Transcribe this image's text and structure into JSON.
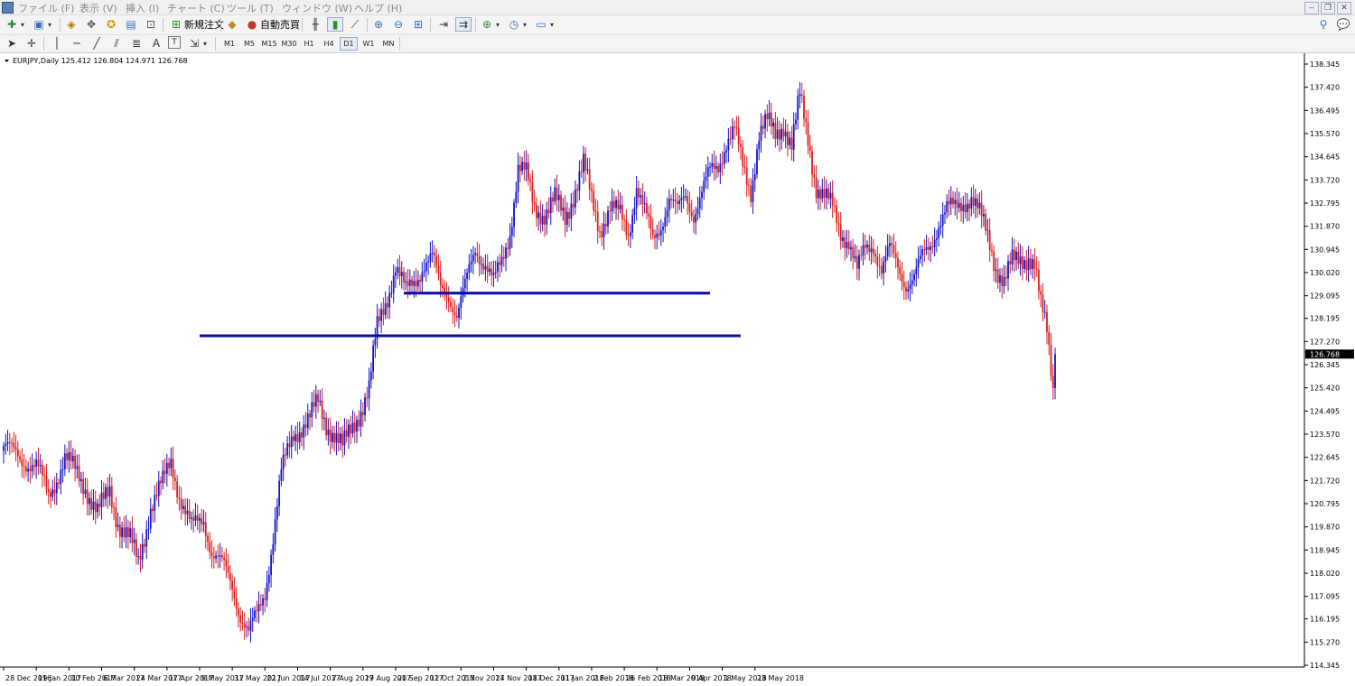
{
  "menu": {
    "items": [
      "ファイル (F)",
      "表示 (V)",
      "挿入 (I)",
      "チャート (C)",
      "ツール (T)",
      "ウィンドウ (W)",
      "ヘルプ (H)"
    ]
  },
  "toolbar": {
    "new_order_label": "新規注文",
    "auto_trade_label": "自動売買",
    "timeframes": [
      "M1",
      "M5",
      "M15",
      "M30",
      "H1",
      "H4",
      "D1",
      "W1",
      "MN"
    ],
    "active_timeframe": "D1",
    "text_tool_label": "A",
    "label_tool_label": "T"
  },
  "colors": {
    "bull": "#1414c8",
    "bear": "#dc1e1e",
    "level_line": "#0a0aa8",
    "price_tag_bg": "#000000"
  },
  "chart_data": {
    "type": "candlestick",
    "title": "EURJPY,Daily  125.412 126.804 124.971 126.768",
    "symbol": "EURJPY",
    "period": "Daily",
    "ohlc_header": {
      "open": 125.412,
      "high": 126.804,
      "low": 124.971,
      "close": 126.768
    },
    "last_price_label": "126.768",
    "last_price": 126.768,
    "ylim": [
      114.345,
      138.345
    ],
    "y_ticks": [
      "138.345",
      "137.420",
      "136.495",
      "135.570",
      "134.645",
      "133.720",
      "132.795",
      "131.870",
      "130.945",
      "130.020",
      "129.095",
      "128.195",
      "127.270",
      "126.345",
      "125.420",
      "124.495",
      "123.570",
      "122.645",
      "121.720",
      "120.795",
      "119.870",
      "118.945",
      "118.020",
      "117.095",
      "116.195",
      "115.270",
      "114.345"
    ],
    "x_ticks": [
      "28 Dec 2016",
      "19 Jan 2017",
      "10 Feb 2017",
      "6 Mar 2017",
      "24 Mar 2017",
      "17 Apr 2017",
      "9 May 2017",
      "31 May 2017",
      "22 Jun 2017",
      "14 Jul 2017",
      "7 Aug 2017",
      "29 Aug 2017",
      "20 Sep 2017",
      "12 Oct 2017",
      "2 Nov 2017",
      "24 Nov 2017",
      "18 Dec 2017",
      "11 Jan 2018",
      "2 Feb 2018",
      "26 Feb 2018",
      "18 Mar 2018",
      "9 Apr 2018",
      "1 May 2018",
      "23 May 2018"
    ],
    "x_domain": [
      0,
      1444
    ],
    "x_tick_positions": [
      0,
      16,
      32,
      48,
      64,
      80,
      96,
      112,
      128,
      144,
      160,
      176,
      192,
      208,
      224,
      240,
      256,
      272,
      288,
      304,
      320,
      336,
      352,
      368
    ],
    "price_path": [
      [
        0,
        123.1
      ],
      [
        8,
        122.6
      ],
      [
        16,
        122.3
      ],
      [
        22,
        121.1
      ],
      [
        30,
        122.6
      ],
      [
        34,
        122.2
      ],
      [
        40,
        121.5
      ],
      [
        46,
        120.4
      ],
      [
        52,
        121.3
      ],
      [
        56,
        120.1
      ],
      [
        62,
        119.3
      ],
      [
        66,
        118.4
      ],
      [
        72,
        120.7
      ],
      [
        78,
        121.6
      ],
      [
        82,
        122.5
      ],
      [
        86,
        121.2
      ],
      [
        92,
        119.8
      ],
      [
        98,
        120.2
      ],
      [
        102,
        118.9
      ],
      [
        108,
        118.2
      ],
      [
        112,
        117.5
      ],
      [
        116,
        116.4
      ],
      [
        120,
        115.6
      ],
      [
        124,
        116.3
      ],
      [
        128,
        117.3
      ],
      [
        132,
        119.5
      ],
      [
        136,
        122.0
      ],
      [
        142,
        123.6
      ],
      [
        146,
        123.9
      ],
      [
        150,
        124.2
      ],
      [
        154,
        124.8
      ],
      [
        158,
        124.0
      ],
      [
        162,
        123.6
      ],
      [
        166,
        123.0
      ],
      [
        170,
        123.7
      ],
      [
        175,
        124.6
      ],
      [
        179,
        125.4
      ],
      [
        183,
        127.8
      ],
      [
        188,
        129.1
      ],
      [
        192,
        130.3
      ],
      [
        197,
        129.2
      ],
      [
        202,
        129.8
      ],
      [
        206,
        130.4
      ],
      [
        210,
        130.6
      ],
      [
        214,
        129.4
      ],
      [
        218,
        129.2
      ],
      [
        222,
        128.3
      ],
      [
        226,
        129.4
      ],
      [
        231,
        131.0
      ],
      [
        236,
        130.4
      ],
      [
        240,
        129.6
      ],
      [
        244,
        130.4
      ],
      [
        248,
        131.7
      ],
      [
        252,
        134.2
      ],
      [
        256,
        133.9
      ],
      [
        260,
        132.6
      ],
      [
        265,
        132.4
      ],
      [
        270,
        132.9
      ],
      [
        275,
        132.2
      ],
      [
        280,
        133.4
      ],
      [
        284,
        134.3
      ],
      [
        288,
        132.9
      ],
      [
        292,
        131.8
      ],
      [
        297,
        132.6
      ],
      [
        302,
        132.3
      ],
      [
        306,
        131.6
      ],
      [
        310,
        133.5
      ],
      [
        314,
        132.4
      ],
      [
        318,
        131.3
      ],
      [
        322,
        132.0
      ],
      [
        326,
        133.0
      ],
      [
        330,
        132.4
      ],
      [
        334,
        133.1
      ],
      [
        338,
        132.4
      ],
      [
        342,
        133.2
      ],
      [
        346,
        134.0
      ],
      [
        350,
        134.3
      ],
      [
        354,
        135.3
      ],
      [
        358,
        135.7
      ],
      [
        362,
        134.2
      ],
      [
        366,
        133.3
      ],
      [
        370,
        135.6
      ],
      [
        374,
        136.0
      ],
      [
        378,
        135.5
      ],
      [
        382,
        136.0
      ],
      [
        386,
        135.1
      ],
      [
        390,
        137.0
      ],
      [
        394,
        135.4
      ],
      [
        398,
        133.5
      ],
      [
        402,
        133.0
      ],
      [
        406,
        132.6
      ],
      [
        410,
        131.7
      ],
      [
        414,
        131.3
      ],
      [
        418,
        130.0
      ],
      [
        422,
        131.0
      ],
      [
        426,
        131.2
      ],
      [
        430,
        130.1
      ],
      [
        434,
        130.9
      ],
      [
        438,
        130.3
      ],
      [
        442,
        129.6
      ],
      [
        446,
        129.8
      ],
      [
        450,
        130.6
      ],
      [
        454,
        131.2
      ],
      [
        458,
        132.0
      ],
      [
        462,
        132.5
      ],
      [
        466,
        132.6
      ],
      [
        470,
        132.9
      ],
      [
        474,
        133.0
      ],
      [
        478,
        132.3
      ],
      [
        482,
        131.5
      ],
      [
        486,
        130.3
      ],
      [
        490,
        129.6
      ],
      [
        494,
        130.4
      ],
      [
        498,
        130.6
      ],
      [
        502,
        130.7
      ],
      [
        505,
        130.3
      ],
      [
        508,
        128.6
      ],
      [
        511,
        127.7
      ],
      [
        514,
        125.5
      ],
      [
        515,
        126.768
      ]
    ],
    "levels": [
      {
        "price": 129.2,
        "x_from": 196,
        "x_to": 346
      },
      {
        "price": 127.5,
        "x_from": 96,
        "x_to": 361
      }
    ]
  }
}
